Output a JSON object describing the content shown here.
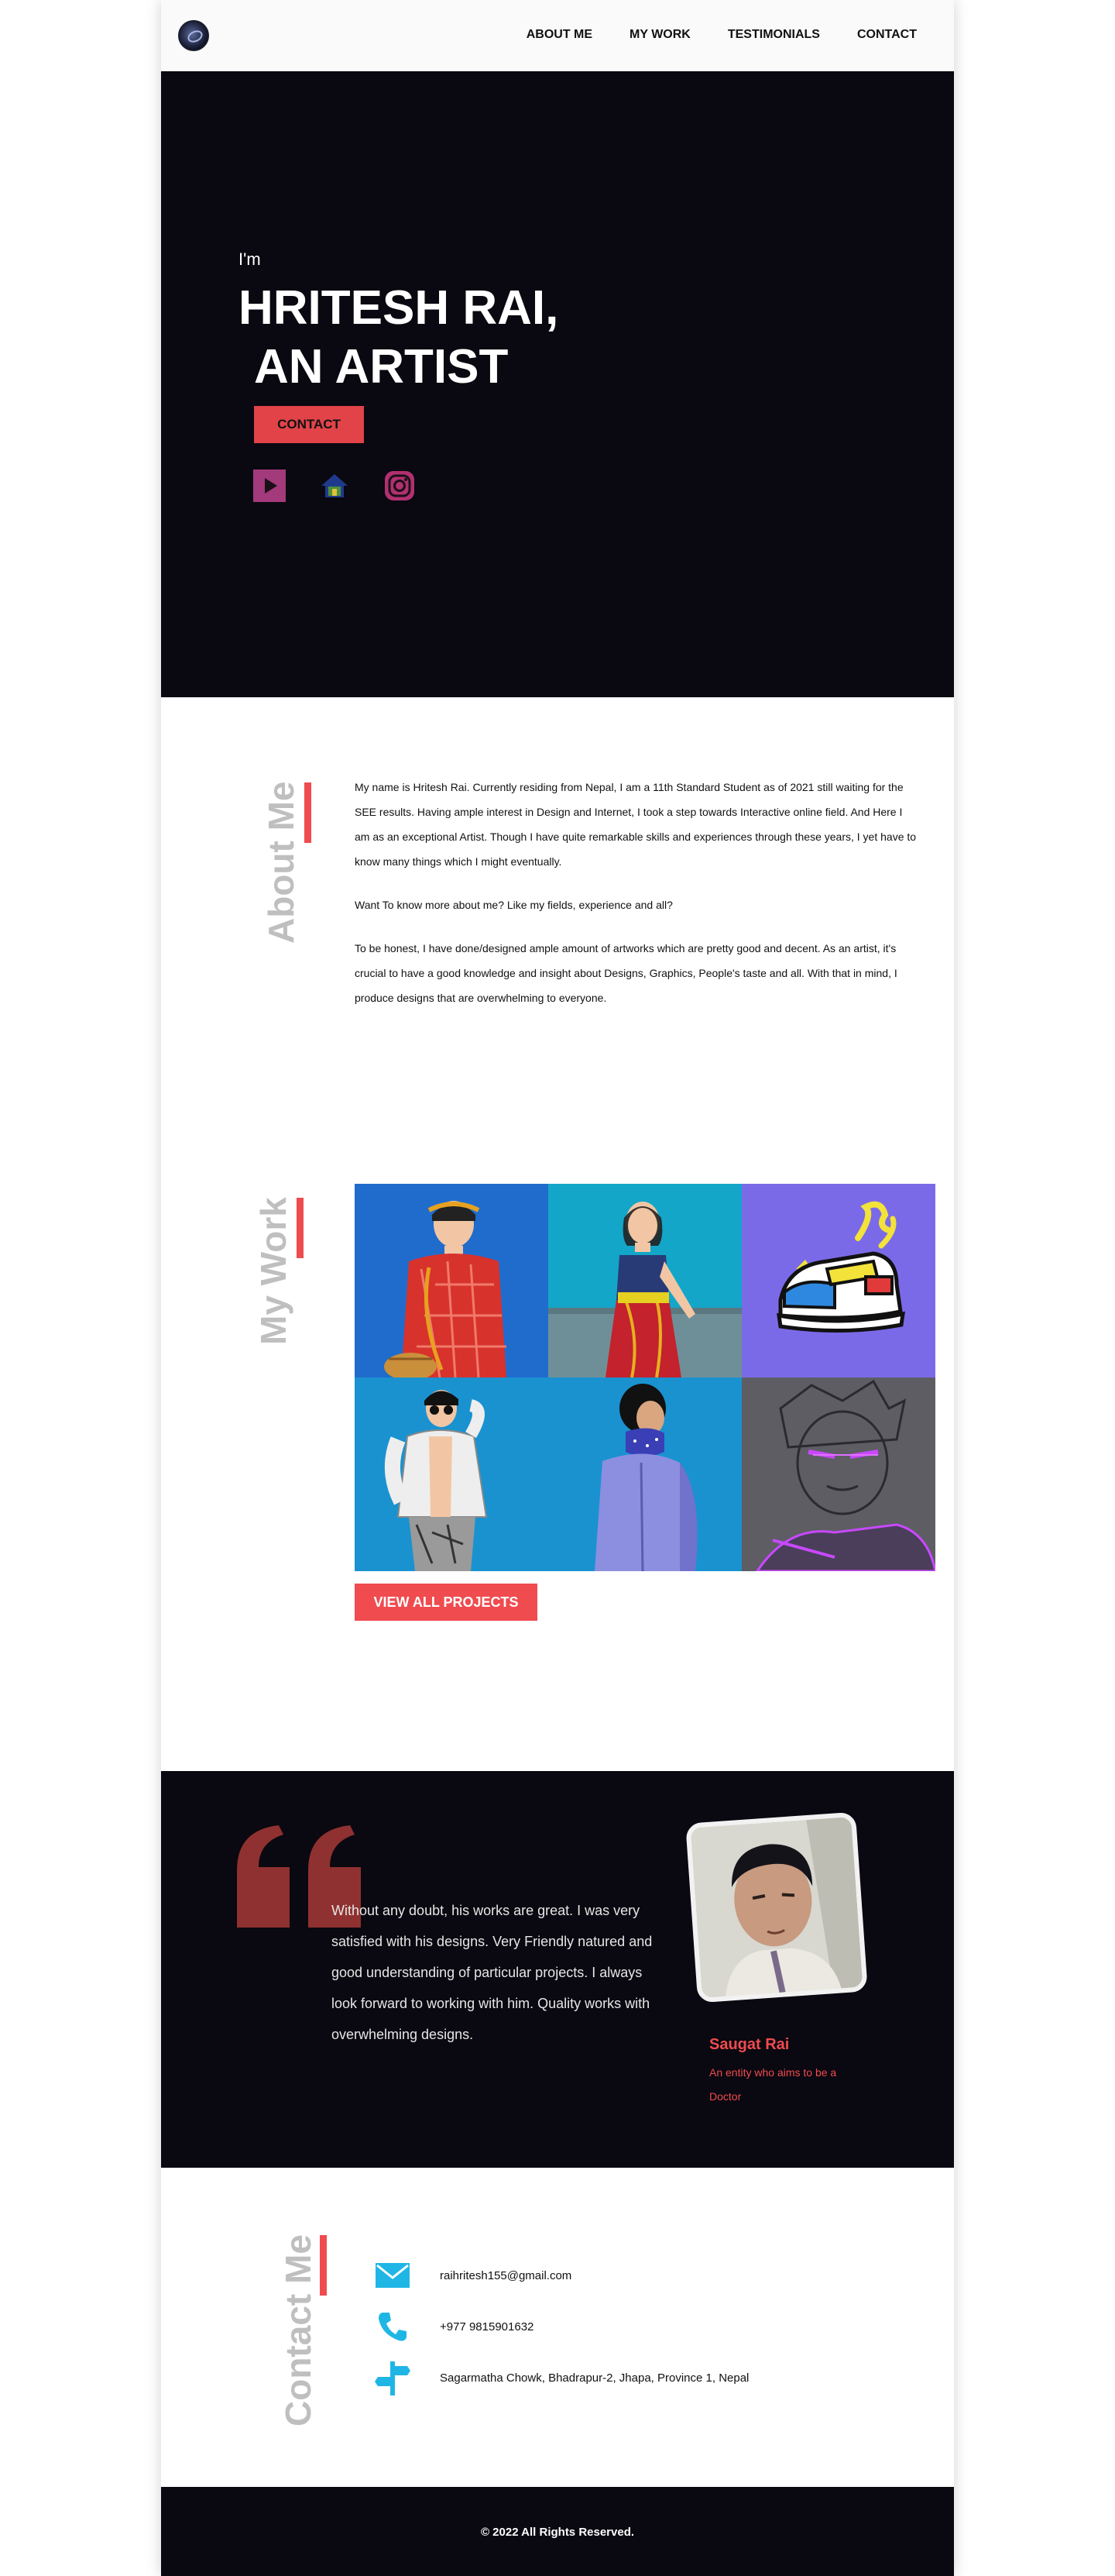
{
  "nav": {
    "links": [
      "ABOUT ME",
      "MY WORK",
      "TESTIMONIALS",
      "CONTACT"
    ]
  },
  "hero": {
    "intro": "I'm",
    "title_line1": "HRITESH RAI,",
    "title_line2": "AN ARTIST",
    "button": "CONTACT",
    "social_icons": [
      "youtube-icon",
      "home-icon",
      "instagram-icon"
    ]
  },
  "about": {
    "label": "About Me",
    "paragraphs": [
      "My name is Hritesh Rai. Currently residing from Nepal, I am a 11th Standard Student as of 2021 still waiting for the SEE results. Having ample interest in Design and Internet, I took a step towards Interactive online field. And Here I am as an exceptional Artist. Though I have quite remarkable skills and experiences through these years, I yet have to know many things which I might eventually.",
      "Want To know more about me? Like my fields, experience and all?",
      "To be honest, I have done/designed ample amount of artworks which are pretty good and decent. As an artist, it's crucial to have a good knowledge and insight about Designs, Graphics, People's taste and all. With that in mind, I produce designs that are overwhelming to everyone."
    ]
  },
  "work": {
    "label": "My Work",
    "button": "VIEW ALL PROJECTS",
    "tiles": [
      "woman-in-red-shawl",
      "woman-in-red-sari",
      "sneaker-illustration",
      "man-in-sunglasses",
      "man-with-bandana",
      "purple-sketch-portrait"
    ]
  },
  "testimonial": {
    "quote": "Without any doubt, his works are great. I was very satisfied with his designs. Very Friendly natured and good understanding of particular projects. I always look forward to working with him. Quality works with overwhelming designs.",
    "name": "Saugat Rai",
    "role": "An entity who aims to be a Doctor"
  },
  "contact": {
    "label": "Contact Me",
    "email": "raihritesh155@gmail.com",
    "phone": "+977 9815901632",
    "address": "Sagarmatha Chowk, Bhadrapur-2, Jhapa, Province 1, Nepal"
  },
  "footer": {
    "text": "© 2022 All Rights Reserved."
  },
  "colors": {
    "accent": "#f04b4f",
    "dark_bg": "#0a0810",
    "contact_icon": "#1fb6e6"
  }
}
